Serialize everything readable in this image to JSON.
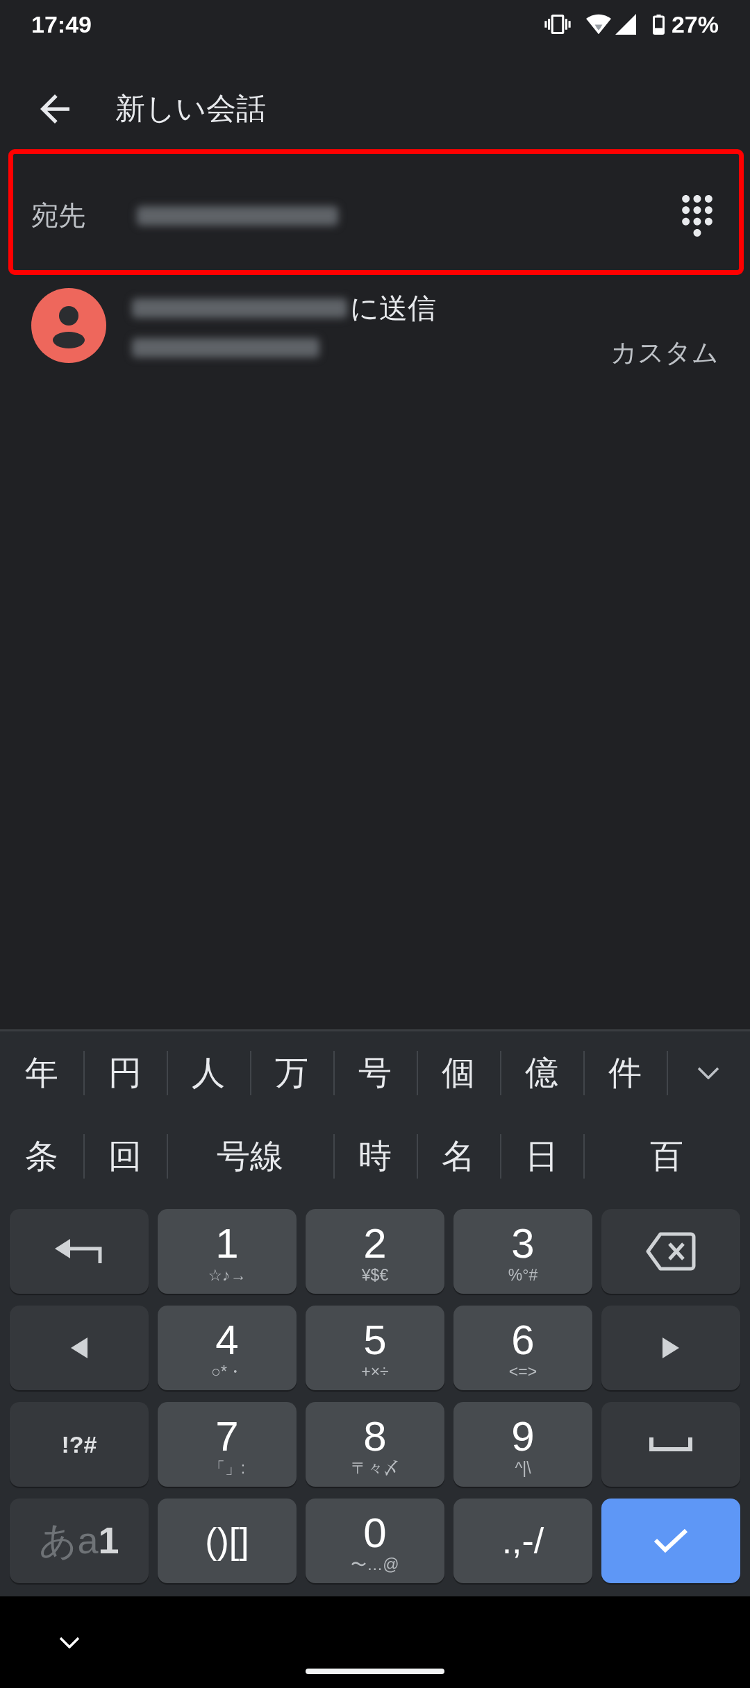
{
  "status_bar": {
    "time": "17:49",
    "battery": "27%"
  },
  "header": {
    "title": "新しい会話"
  },
  "recipient": {
    "label": "宛先",
    "highlighted": true
  },
  "suggestion": {
    "action": "に送信",
    "type": "カスタム"
  },
  "keyboard": {
    "candidates": [
      [
        "年",
        "円",
        "人",
        "万",
        "号",
        "個",
        "億",
        "件"
      ],
      [
        "条",
        "回",
        "号線",
        "時",
        "名",
        "日",
        "百"
      ]
    ],
    "keys": [
      {
        "kind": "undo"
      },
      {
        "kind": "digit",
        "label": "1",
        "symbols": "☆♪→"
      },
      {
        "kind": "digit",
        "label": "2",
        "symbols": "¥$€"
      },
      {
        "kind": "digit",
        "label": "3",
        "symbols": "%°#"
      },
      {
        "kind": "backspace"
      },
      {
        "kind": "cursor_left"
      },
      {
        "kind": "digit",
        "label": "4",
        "symbols": "○*・"
      },
      {
        "kind": "digit",
        "label": "5",
        "symbols": "+×÷"
      },
      {
        "kind": "digit",
        "label": "6",
        "symbols": "<=>"
      },
      {
        "kind": "cursor_right"
      },
      {
        "kind": "function",
        "label": "!?#"
      },
      {
        "kind": "digit",
        "label": "7",
        "symbols": "「」:"
      },
      {
        "kind": "digit",
        "label": "8",
        "symbols": "〒々〆"
      },
      {
        "kind": "digit",
        "label": "9",
        "symbols": "^|\\"
      },
      {
        "kind": "space"
      },
      {
        "kind": "mode",
        "parts": [
          {
            "text": "あ",
            "selected": false
          },
          {
            "text": "a",
            "selected": false
          },
          {
            "text": "1",
            "selected": true
          }
        ]
      },
      {
        "kind": "char",
        "label": "()[]"
      },
      {
        "kind": "digit",
        "label": "0",
        "symbols": "〜…@"
      },
      {
        "kind": "char",
        "label": ".,-/"
      },
      {
        "kind": "enter"
      }
    ]
  }
}
